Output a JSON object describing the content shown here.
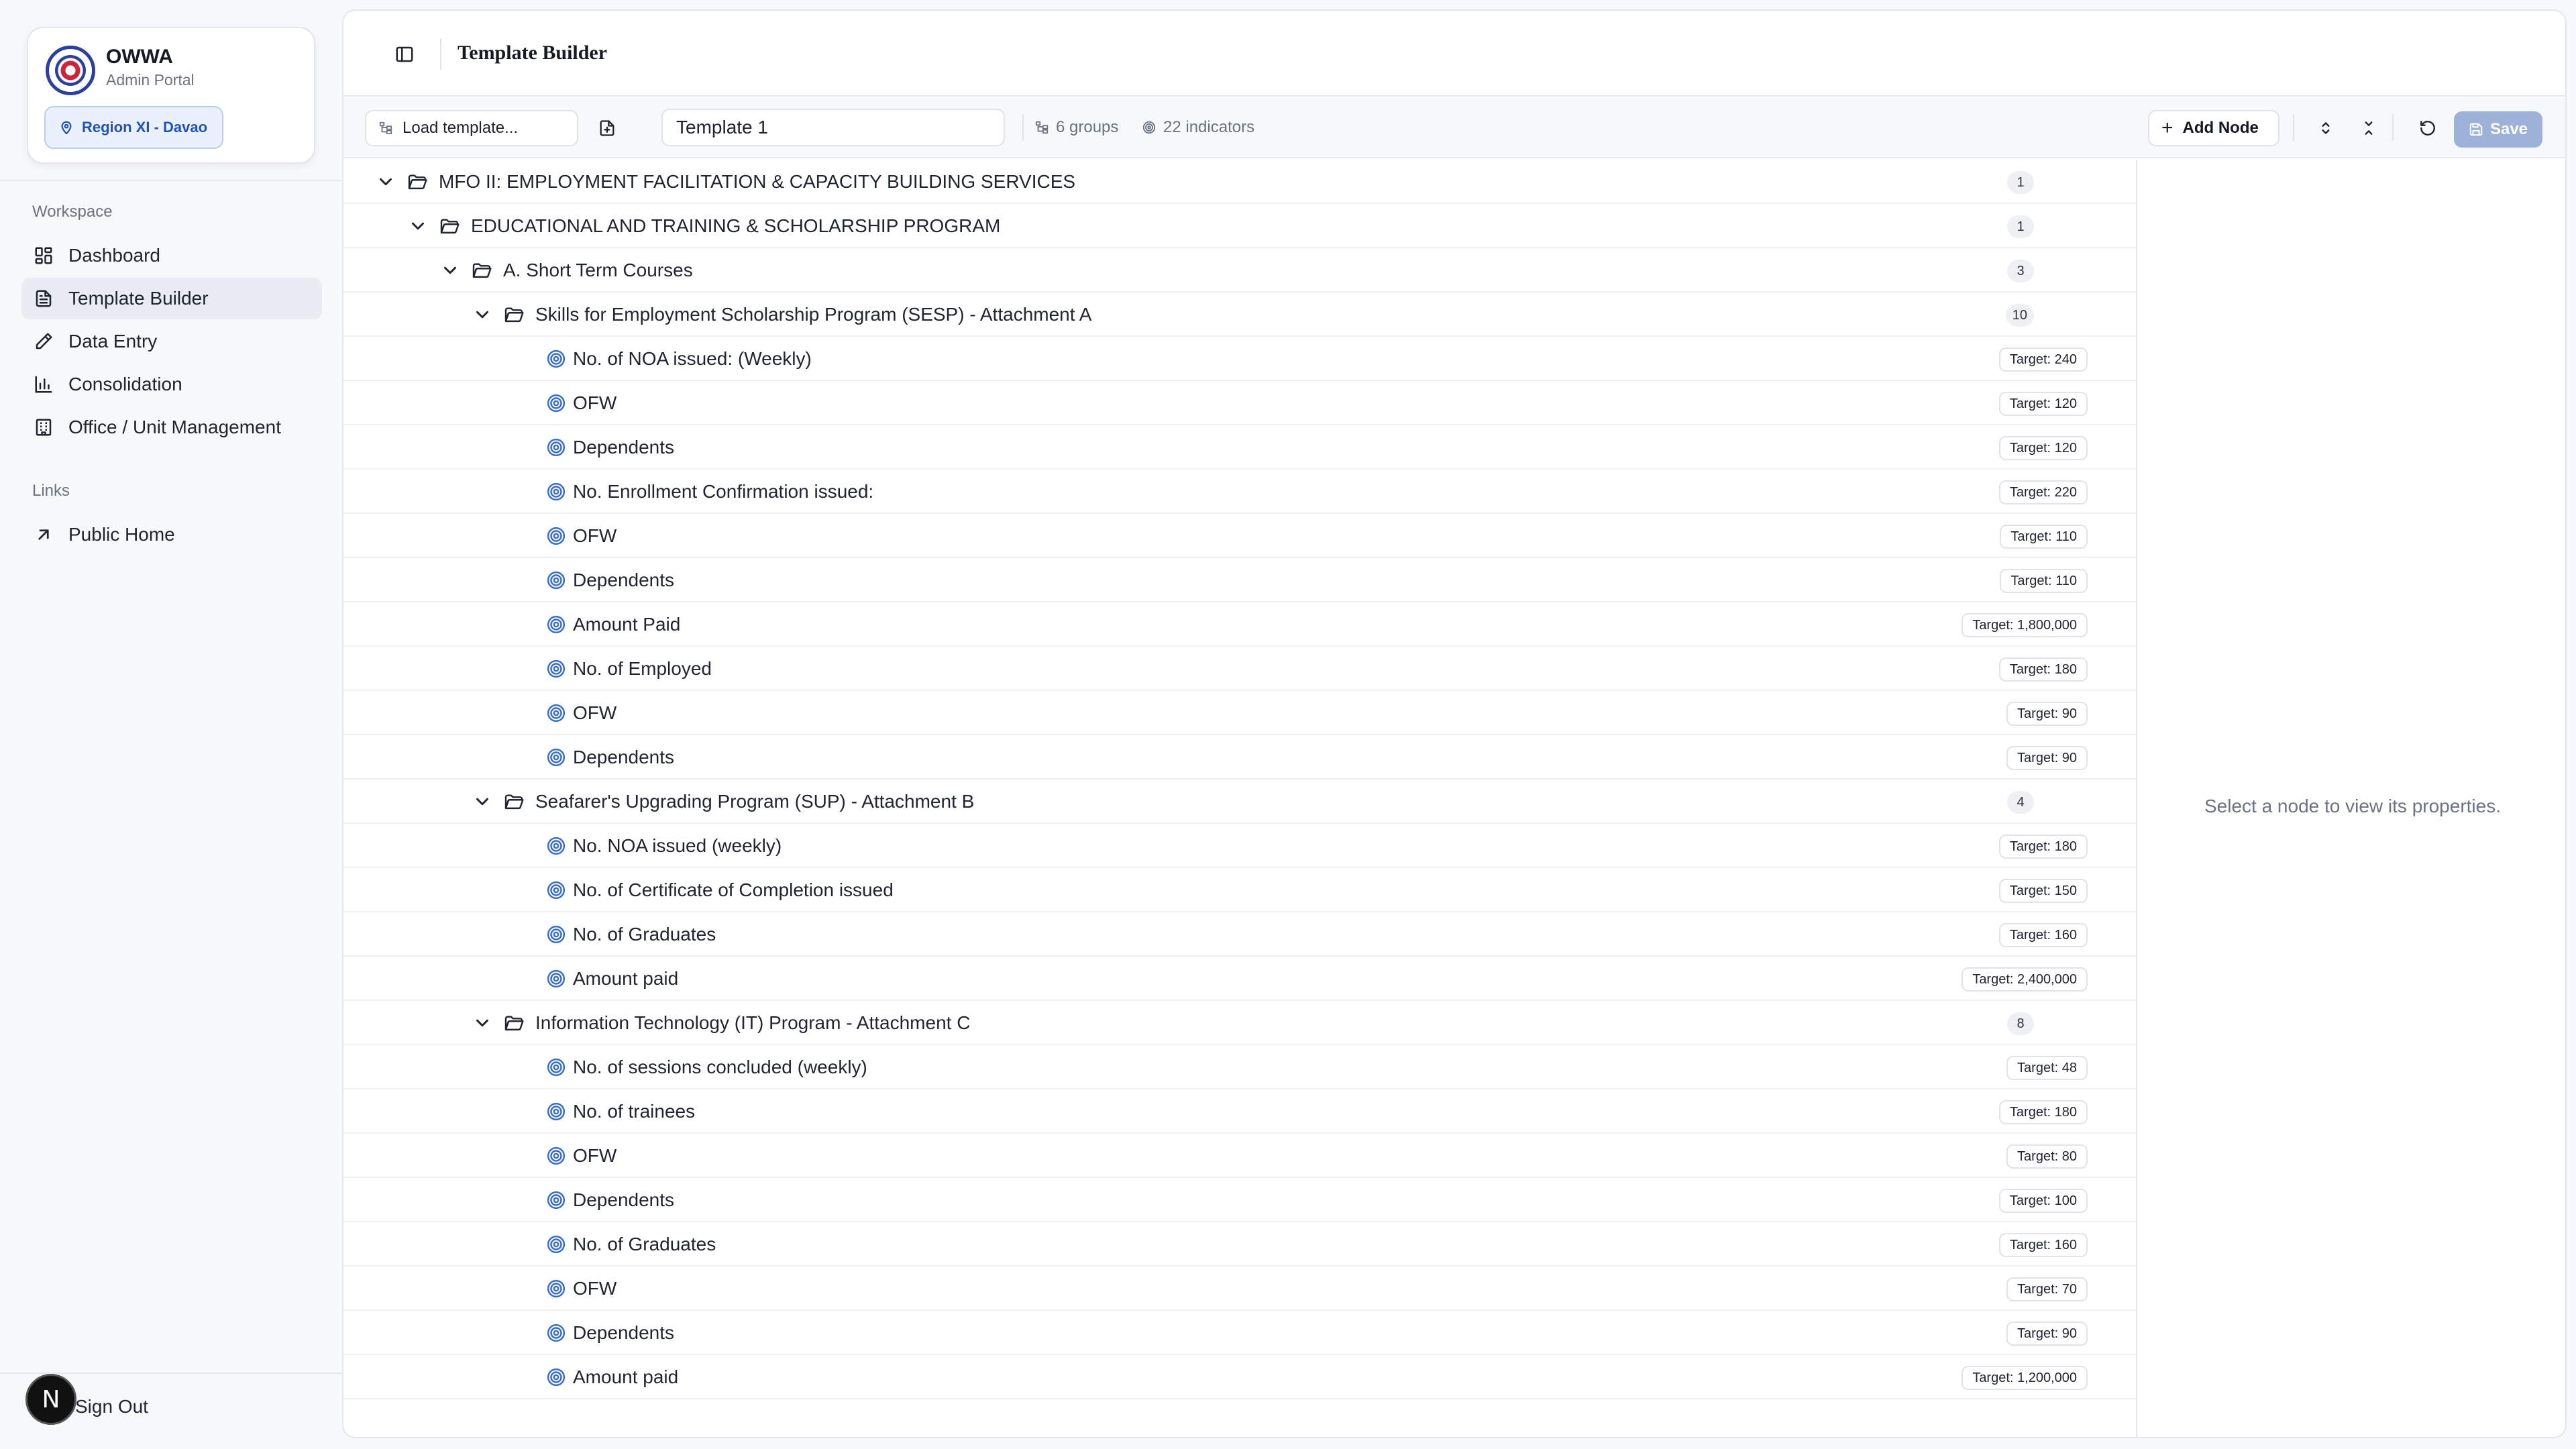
{
  "brand": {
    "name": "OWWA",
    "subtitle": "Admin Portal",
    "region": "Region XI - Davao"
  },
  "sidebar": {
    "workspace_label": "Workspace",
    "items": [
      {
        "label": "Dashboard",
        "icon": "dashboard-icon"
      },
      {
        "label": "Template Builder",
        "icon": "file-text-icon",
        "active": true
      },
      {
        "label": "Data Entry",
        "icon": "pencil-icon"
      },
      {
        "label": "Consolidation",
        "icon": "bar-chart-icon"
      },
      {
        "label": "Office / Unit Management",
        "icon": "building-icon"
      }
    ],
    "links_label": "Links",
    "links": [
      {
        "label": "Public Home",
        "icon": "arrow-up-right-icon"
      }
    ],
    "sign_out": "Sign Out",
    "user_initial": "N"
  },
  "header": {
    "title": "Template Builder"
  },
  "toolbar": {
    "load_template": "Load template...",
    "template_name": "Template 1",
    "groups_count": "6 groups",
    "indicators_count": "22 indicators",
    "add_node": "Add Node",
    "save": "Save"
  },
  "tree": [
    {
      "type": "group",
      "level": 0,
      "label": "MFO II: EMPLOYMENT FACILITATION & CAPACITY BUILDING SERVICES",
      "count": "1"
    },
    {
      "type": "group",
      "level": 1,
      "label": "EDUCATIONAL AND TRAINING & SCHOLARSHIP PROGRAM",
      "count": "1"
    },
    {
      "type": "group",
      "level": 2,
      "label": "A. Short Term Courses",
      "count": "3"
    },
    {
      "type": "group",
      "level": 3,
      "label": "Skills for Employment Scholarship Program (SESP) - Attachment A",
      "count": "10"
    },
    {
      "type": "indicator",
      "label": "No. of NOA issued: (Weekly)",
      "target": "Target: 240"
    },
    {
      "type": "indicator",
      "label": "OFW",
      "target": "Target: 120"
    },
    {
      "type": "indicator",
      "label": "Dependents",
      "target": "Target: 120"
    },
    {
      "type": "indicator",
      "label": "No. Enrollment Confirmation issued:",
      "target": "Target: 220"
    },
    {
      "type": "indicator",
      "label": "OFW",
      "target": "Target: 110"
    },
    {
      "type": "indicator",
      "label": "Dependents",
      "target": "Target: 110"
    },
    {
      "type": "indicator",
      "label": "Amount Paid",
      "target": "Target: 1,800,000"
    },
    {
      "type": "indicator",
      "label": "No. of Employed",
      "target": "Target: 180"
    },
    {
      "type": "indicator",
      "label": "OFW",
      "target": "Target: 90"
    },
    {
      "type": "indicator",
      "label": "Dependents",
      "target": "Target: 90"
    },
    {
      "type": "group",
      "level": 3,
      "label": "Seafarer's Upgrading Program (SUP) - Attachment B",
      "count": "4"
    },
    {
      "type": "indicator",
      "label": "No. NOA issued (weekly)",
      "target": "Target: 180"
    },
    {
      "type": "indicator",
      "label": "No. of Certificate of Completion issued",
      "target": "Target: 150"
    },
    {
      "type": "indicator",
      "label": "No. of Graduates",
      "target": "Target: 160"
    },
    {
      "type": "indicator",
      "label": "Amount paid",
      "target": "Target: 2,400,000"
    },
    {
      "type": "group",
      "level": 3,
      "label": "Information Technology (IT) Program - Attachment C",
      "count": "8"
    },
    {
      "type": "indicator",
      "label": "No. of sessions concluded (weekly)",
      "target": "Target: 48"
    },
    {
      "type": "indicator",
      "label": "No. of trainees",
      "target": "Target: 180"
    },
    {
      "type": "indicator",
      "label": "OFW",
      "target": "Target: 80"
    },
    {
      "type": "indicator",
      "label": "Dependents",
      "target": "Target: 100"
    },
    {
      "type": "indicator",
      "label": "No. of Graduates",
      "target": "Target: 160"
    },
    {
      "type": "indicator",
      "label": "OFW",
      "target": "Target: 70"
    },
    {
      "type": "indicator",
      "label": "Dependents",
      "target": "Target: 90"
    },
    {
      "type": "indicator",
      "label": "Amount paid",
      "target": "Target: 1,200,000"
    }
  ],
  "properties": {
    "empty_message": "Select a node to view its properties."
  },
  "colors": {
    "accent": "#2153b6",
    "indicator_icon": "#3a6fc9",
    "save_disabled": "#9db2d8"
  }
}
